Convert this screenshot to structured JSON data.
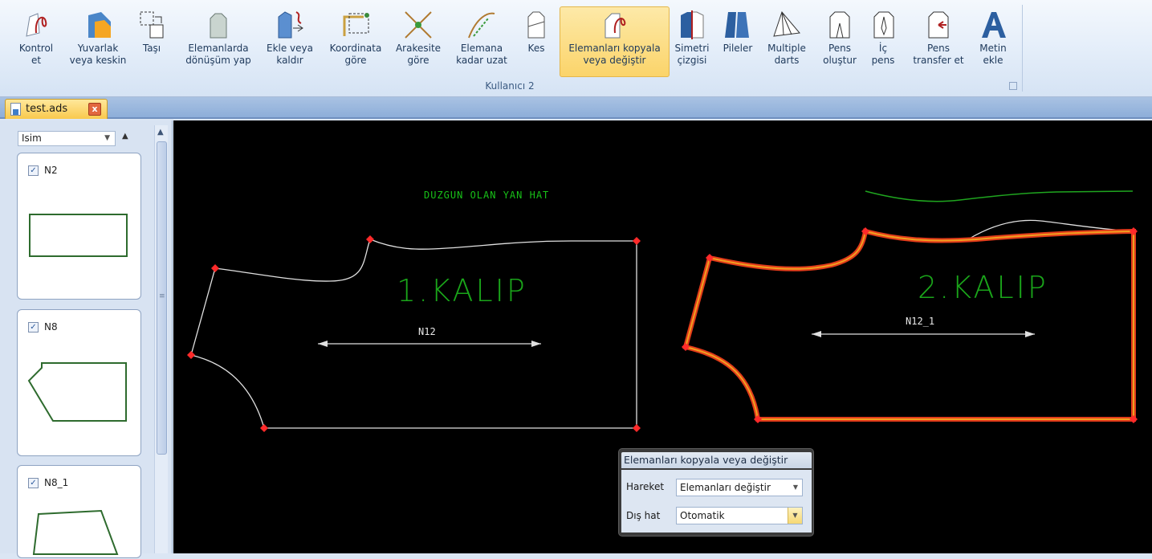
{
  "ribbon": {
    "group_label": "Kullanıcı 2",
    "buttons": [
      {
        "id": "kontrol",
        "label1": "Kontrol",
        "label2": "et",
        "icon": "control-point-icon"
      },
      {
        "id": "yuvarlak",
        "label1": "Yuvarlak",
        "label2": "veya keskin",
        "icon": "round-corner-icon"
      },
      {
        "id": "tasi",
        "label1": "Taşı",
        "label2": "",
        "icon": "move-icon"
      },
      {
        "id": "donusum",
        "label1": "Elemanlarda",
        "label2": "dönüşüm yap",
        "icon": "transform-icon"
      },
      {
        "id": "ekle",
        "label1": "Ekle veya",
        "label2": "kaldır",
        "icon": "add-remove-icon"
      },
      {
        "id": "koordinata",
        "label1": "Koordinata",
        "label2": "göre",
        "icon": "coordinate-icon"
      },
      {
        "id": "arakesite",
        "label1": "Arakesite",
        "label2": "göre",
        "icon": "intersection-icon"
      },
      {
        "id": "uzat",
        "label1": "Elemana",
        "label2": "kadar uzat",
        "icon": "extend-icon"
      },
      {
        "id": "kes",
        "label1": "Kes",
        "label2": "",
        "icon": "cut-icon"
      },
      {
        "id": "kopyala",
        "label1": "Elemanları kopyala",
        "label2": "veya değiştir",
        "icon": "copy-replace-icon"
      },
      {
        "id": "simetri",
        "label1": "Simetri",
        "label2": "çizgisi",
        "icon": "symmetry-icon"
      },
      {
        "id": "pileler",
        "label1": "Pileler",
        "label2": "",
        "icon": "pleats-icon"
      },
      {
        "id": "multiple",
        "label1": "Multiple",
        "label2": "darts",
        "icon": "multiple-darts-icon"
      },
      {
        "id": "pens",
        "label1": "Pens",
        "label2": "oluştur",
        "icon": "create-dart-icon"
      },
      {
        "id": "icpens",
        "label1": "İç",
        "label2": "pens",
        "icon": "inner-dart-icon"
      },
      {
        "id": "transfer",
        "label1": "Pens",
        "label2": "transfer et",
        "icon": "dart-transfer-icon"
      },
      {
        "id": "metin",
        "label1": "Metin",
        "label2": "ekle",
        "icon": "text-icon"
      }
    ]
  },
  "document_tab": {
    "title": "test.ads",
    "close": "x"
  },
  "left_panel": {
    "sort_label": "Isim",
    "items": [
      {
        "name": "N2",
        "checked": "✓"
      },
      {
        "name": "N8",
        "checked": "✓"
      },
      {
        "name": "N8_1",
        "checked": "✓"
      }
    ]
  },
  "canvas": {
    "note": "DUZGUN OLAN YAN HAT",
    "pattern1": {
      "title": "1.KALIP",
      "name": "N12"
    },
    "pattern2": {
      "title": "2.KALIP",
      "name": "N12_1"
    }
  },
  "dialog": {
    "title": "Elemanları kopyala veya değiştir",
    "fields": [
      {
        "label": "Hareket",
        "value": "Elemanları değiştir"
      },
      {
        "label": "Dış hat",
        "value": "Otomatik"
      }
    ]
  },
  "colors": {
    "canvas_bg": "#000000",
    "outline": "#e0e0e0",
    "point": "#ff2a2a",
    "selection": "#e23b1a",
    "selection_fill": "#f0a020",
    "text_green": "#1aa51a",
    "green_line": "#1fa51f",
    "card_shape": "#2e6b2e"
  }
}
